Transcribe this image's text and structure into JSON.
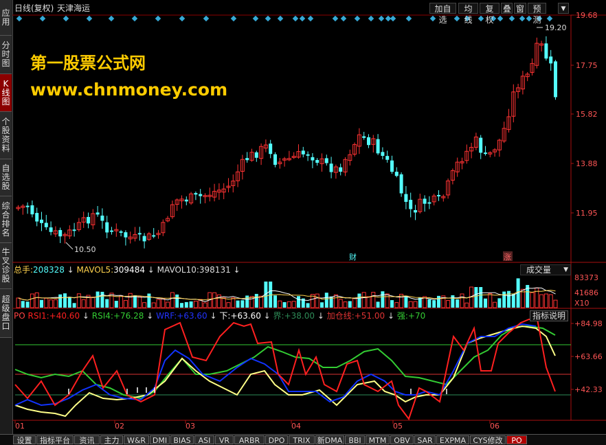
{
  "sidebar": {
    "tabs": [
      {
        "label": "应\n用",
        "active": false
      },
      {
        "label": "分\n时\n图",
        "active": false
      },
      {
        "label": "K\n线\n图",
        "active": true
      },
      {
        "label": "个\n股\n资\n料",
        "active": false
      },
      {
        "label": "自\n选\n股",
        "active": false
      },
      {
        "label": "综\n合\n排\n名",
        "active": false
      },
      {
        "label": "牛\n叉\n诊\n股",
        "active": false
      },
      {
        "label": "超\n级\n盘\n口",
        "active": false
      }
    ]
  },
  "header": {
    "period": "日线(复权)",
    "stock_name": "天津海运",
    "buttons": [
      "加自选",
      "均线",
      "复权",
      "叠",
      "窗",
      "预测"
    ],
    "menu_arrow": "▼"
  },
  "watermark": {
    "line1": "第一股票公式网",
    "line2": "www.chnmoney.com"
  },
  "price_axis": {
    "ticks": [
      "19.68",
      "17.75",
      "15.82",
      "13.88",
      "11.95"
    ],
    "high_label": "19.20",
    "low_label": "10.50",
    "markers": [
      "财",
      "涨"
    ]
  },
  "volume_panel": {
    "total_label": "总手:",
    "total_value": "208328",
    "mavol5_label": "MAVOL5:",
    "mavol5_value": "309484",
    "mavol10_label": "MAVOL10:",
    "mavol10_value": "398131",
    "dropdown_label": "成交量",
    "axis_ticks": [
      "83373",
      "41686",
      "X10"
    ]
  },
  "indicator_panel": {
    "name": "PO",
    "series_labels": [
      {
        "label": "RSI1:",
        "value": "+40.60",
        "color": "#ff2020"
      },
      {
        "label": "RSI4:",
        "value": "+76.28",
        "color": "#33cc33"
      },
      {
        "label": "WRF:",
        "value": "+63.60",
        "color": "#2233ff"
      },
      {
        "label": "下:",
        "value": "+63.60",
        "color": "#ffffff"
      },
      {
        "label": "界:",
        "value": "+38.00",
        "color": "#2e8b57"
      },
      {
        "label": "加仓线:",
        "value": "+51.00",
        "color": "#dd3333"
      },
      {
        "label": "强:",
        "value": "+70",
        "color": "#33cc33"
      }
    ],
    "help_button": "指标说明",
    "axis_ticks": [
      "+84.98",
      "+63.66",
      "+42.33"
    ]
  },
  "x_axis": {
    "month_labels": [
      "01",
      "02",
      "03",
      "04",
      "05",
      "06"
    ]
  },
  "bottom_tabs": [
    {
      "label": "设置",
      "active": false
    },
    {
      "label": "指标平台",
      "active": false
    },
    {
      "label": "资讯",
      "active": false
    },
    {
      "label": "主力",
      "active": false
    },
    {
      "label": "W&R",
      "active": false
    },
    {
      "label": "DMI",
      "active": false
    },
    {
      "label": "BIAS",
      "active": false
    },
    {
      "label": "ASI",
      "active": false
    },
    {
      "label": "VR",
      "active": false
    },
    {
      "label": "ARBR",
      "active": false
    },
    {
      "label": "DPO",
      "active": false
    },
    {
      "label": "TRIX",
      "active": false
    },
    {
      "label": "新DMA",
      "active": false
    },
    {
      "label": "BBI",
      "active": false
    },
    {
      "label": "MTM",
      "active": false
    },
    {
      "label": "OBV",
      "active": false
    },
    {
      "label": "SAR",
      "active": false
    },
    {
      "label": "EXPMA",
      "active": false
    },
    {
      "label": "CYS修改",
      "active": false
    },
    {
      "label": "PO",
      "active": true
    }
  ],
  "colors": {
    "up_candle": "#ff3333",
    "down_candle": "#54fcfc",
    "signal_diamond": "#36a9d6",
    "axis_red": "#aa1111",
    "text_red": "#ff4444"
  },
  "chart_data": {
    "type": "candlestick",
    "x_axis_months": [
      "01",
      "02",
      "03",
      "04",
      "05",
      "06"
    ],
    "price_range": [
      10.5,
      19.68
    ],
    "price_high": 19.2,
    "price_low": 10.5,
    "indicator_range": [
      33,
      85
    ],
    "indicator_reference_lines": [
      70,
      51,
      38
    ]
  }
}
